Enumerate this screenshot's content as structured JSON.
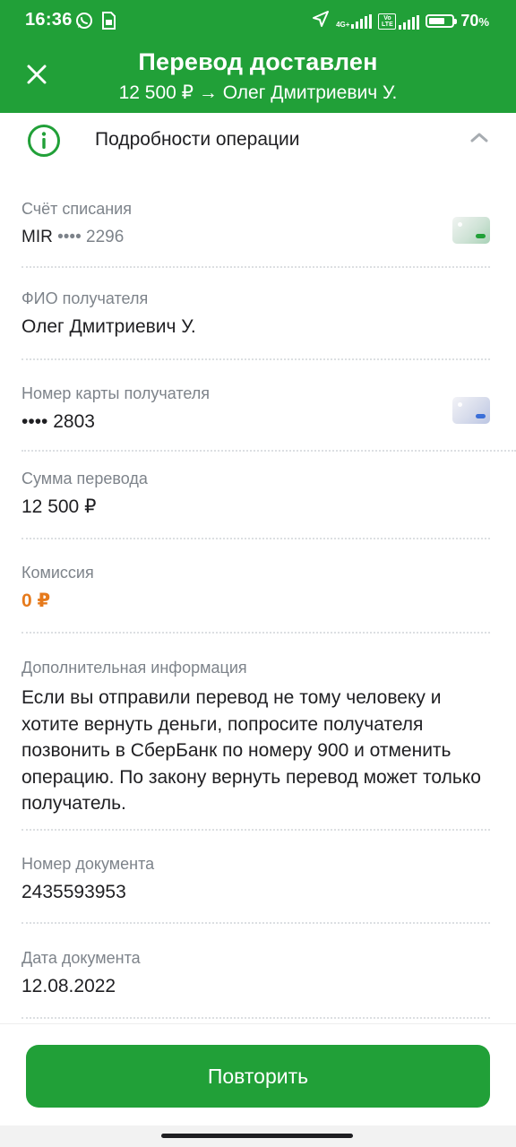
{
  "status_bar": {
    "time": "16:36",
    "network_label": "4G+",
    "volte_label": "Vo LTE",
    "battery_percent": "70",
    "battery_suffix": "%",
    "battery_level": 0.7
  },
  "header": {
    "title": "Перевод доставлен",
    "subtitle": "12 500 ₽ → Олег Дмитриевич У."
  },
  "details": {
    "section_title": "Подробности операции",
    "fields": [
      {
        "label": "Счёт списания",
        "value_prefix": "MIR",
        "value_suffix": "•••• 2296"
      },
      {
        "label": "ФИО получателя",
        "value": "Олег Дмитриевич У."
      },
      {
        "label": "Номер карты получателя",
        "value": "•••• 2803"
      },
      {
        "label": "Сумма перевода",
        "value": "12 500 ₽"
      },
      {
        "label": "Комиссия",
        "value": "0 ₽"
      },
      {
        "label": "Дополнительная информация",
        "value": "Если вы отправили перевод не тому человеку и хотите вернуть деньги, попросите получателя позвонить в СберБанк по номеру 900 и отменить операцию. По закону вернуть перевод может только получатель."
      },
      {
        "label": "Номер документа",
        "value": "2435593953"
      },
      {
        "label": "Дата документа",
        "value": "12.08.2022"
      }
    ]
  },
  "actions": {
    "repeat_label": "Повторить"
  },
  "colors": {
    "brand_green": "#21a038",
    "commission_orange": "#e67a1c",
    "label_gray": "#7d838a"
  },
  "icons": [
    "whatsapp-icon",
    "sim-card-icon",
    "location-arrow-icon",
    "signal-icon",
    "battery-icon",
    "close-icon",
    "info-icon",
    "chevron-up-icon",
    "card-icon"
  ]
}
